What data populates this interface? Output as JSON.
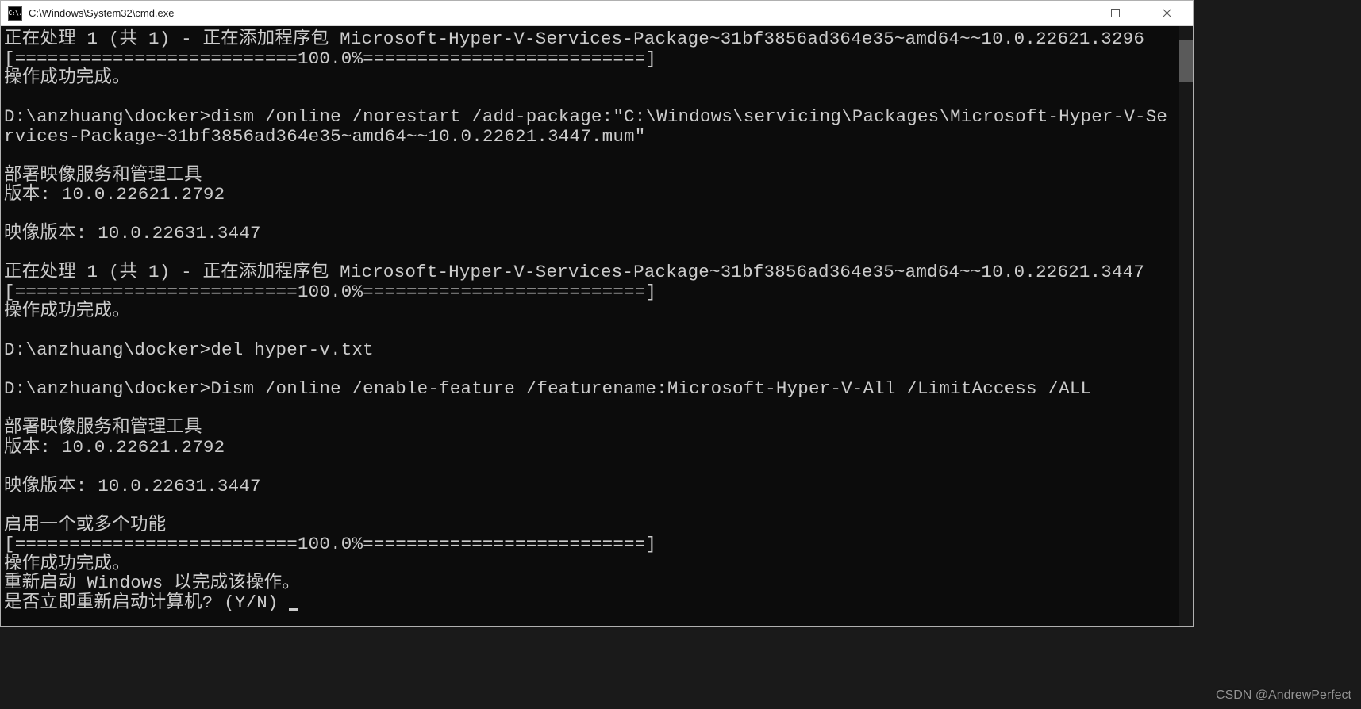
{
  "window": {
    "title": "C:\\Windows\\System32\\cmd.exe",
    "icon_label": "C:\\."
  },
  "terminal": {
    "lines": {
      "proc1": "正在处理 1 (共 1) - 正在添加程序包 Microsoft-Hyper-V-Services-Package~31bf3856ad364e35~amd64~~10.0.22621.3296",
      "prog1": "[==========================100.0%==========================]",
      "done1": "操作成功完成。",
      "blank1": "",
      "cmd1": "D:\\anzhuang\\docker>dism /online /norestart /add-package:\"C:\\Windows\\servicing\\Packages\\Microsoft-Hyper-V-Services-Package~31bf3856ad364e35~amd64~~10.0.22621.3447.mum\"",
      "blank2": "",
      "tool1": "部署映像服务和管理工具",
      "ver1": "版本: 10.0.22621.2792",
      "blank3": "",
      "imgver1": "映像版本: 10.0.22631.3447",
      "blank4": "",
      "proc2": "正在处理 1 (共 1) - 正在添加程序包 Microsoft-Hyper-V-Services-Package~31bf3856ad364e35~amd64~~10.0.22621.3447",
      "prog2": "[==========================100.0%==========================]",
      "done2": "操作成功完成。",
      "blank5": "",
      "cmd2": "D:\\anzhuang\\docker>del hyper-v.txt",
      "blank6": "",
      "cmd3": "D:\\anzhuang\\docker>Dism /online /enable-feature /featurename:Microsoft-Hyper-V-All /LimitAccess /ALL",
      "blank7": "",
      "tool2": "部署映像服务和管理工具",
      "ver2": "版本: 10.0.22621.2792",
      "blank8": "",
      "imgver2": "映像版本: 10.0.22631.3447",
      "blank9": "",
      "enable": "启用一个或多个功能",
      "prog3": "[==========================100.0%==========================]",
      "done3": "操作成功完成。",
      "restart": "重新启动 Windows 以完成该操作。",
      "prompt": "是否立即重新启动计算机? (Y/N) "
    }
  },
  "watermark": "CSDN @AndrewPerfect"
}
